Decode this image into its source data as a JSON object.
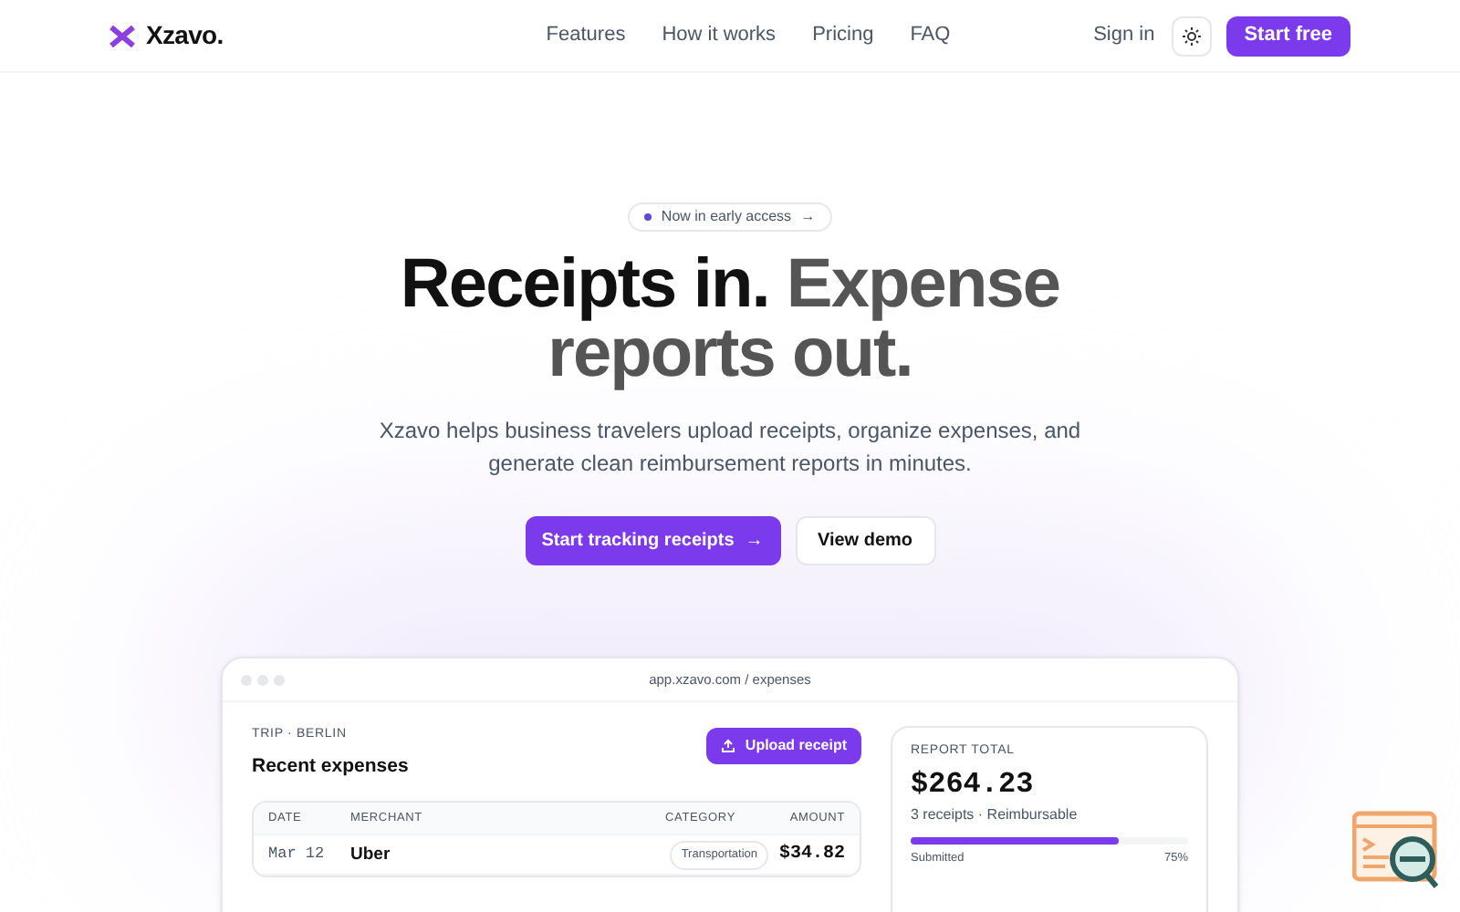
{
  "brand": "Xzavo.",
  "nav": [
    "Features",
    "How it works",
    "Pricing",
    "FAQ"
  ],
  "sign_in": "Sign in",
  "cta": "Start free",
  "badge": {
    "label": "Now in early access",
    "arrow": "→"
  },
  "headline": {
    "dark": "Receipts in.",
    "light": "Expense reports out."
  },
  "subtitle": "Xzavo helps business travelers upload receipts, organize expenses, and generate clean reimbursement reports in minutes.",
  "buttons": [
    {
      "kind": "primary",
      "label": "Start tracking receipts",
      "arrow": "→"
    },
    {
      "kind": "secondary",
      "label": "View demo"
    }
  ],
  "app_window": {
    "url": "app.xzavo.com / expenses",
    "eyebrow": "TRIP · BERLIN",
    "title": "Recent expenses",
    "upload": "Upload receipt",
    "table": {
      "columns": [
        "DATE",
        "MERCHANT",
        "CATEGORY",
        "AMOUNT"
      ],
      "rows": [
        {
          "date": "Mar 12",
          "merchant": "Uber",
          "category": "Transportation",
          "amount": "$34.82"
        }
      ]
    },
    "report": {
      "label": "REPORT TOTAL",
      "total": "$264.23",
      "summary": "3 receipts · Reimbursable",
      "level": 0.75,
      "status": "Submitted",
      "percent": "75%"
    }
  }
}
